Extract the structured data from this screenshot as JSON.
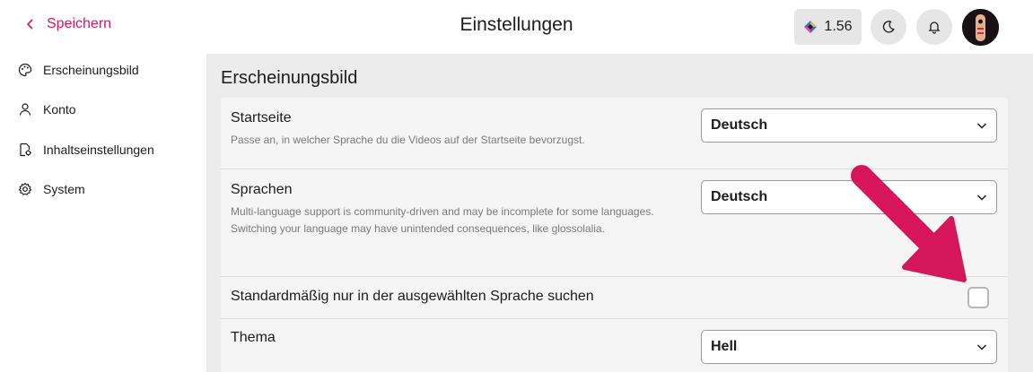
{
  "header": {
    "back_label": "Speichern",
    "title": "Einstellungen",
    "balance": "1.56"
  },
  "sidebar": {
    "items": [
      {
        "label": "Erscheinungsbild",
        "icon": "palette-icon"
      },
      {
        "label": "Konto",
        "icon": "user-icon"
      },
      {
        "label": "Inhaltseinstellungen",
        "icon": "content-settings-icon"
      },
      {
        "label": "System",
        "icon": "gear-icon"
      }
    ]
  },
  "main": {
    "section_title": "Erscheinungsbild",
    "rows": [
      {
        "label": "Startseite",
        "description": "Passe an, in welcher Sprache du die Videos auf der Startseite bevorzugst.",
        "value": "Deutsch"
      },
      {
        "label": "Sprachen",
        "description": "Multi-language support is community-driven and may be incomplete for some languages. Switching your language may have unintended consequences, like glossolalia.",
        "value": "Deutsch"
      },
      {
        "label": "Standardmäßig nur in der ausgewählten Sprache suchen",
        "checked": false
      },
      {
        "label": "Thema",
        "value": "Hell"
      }
    ]
  },
  "colors": {
    "accent": "#e0115f",
    "arrow": "#d6165a"
  }
}
